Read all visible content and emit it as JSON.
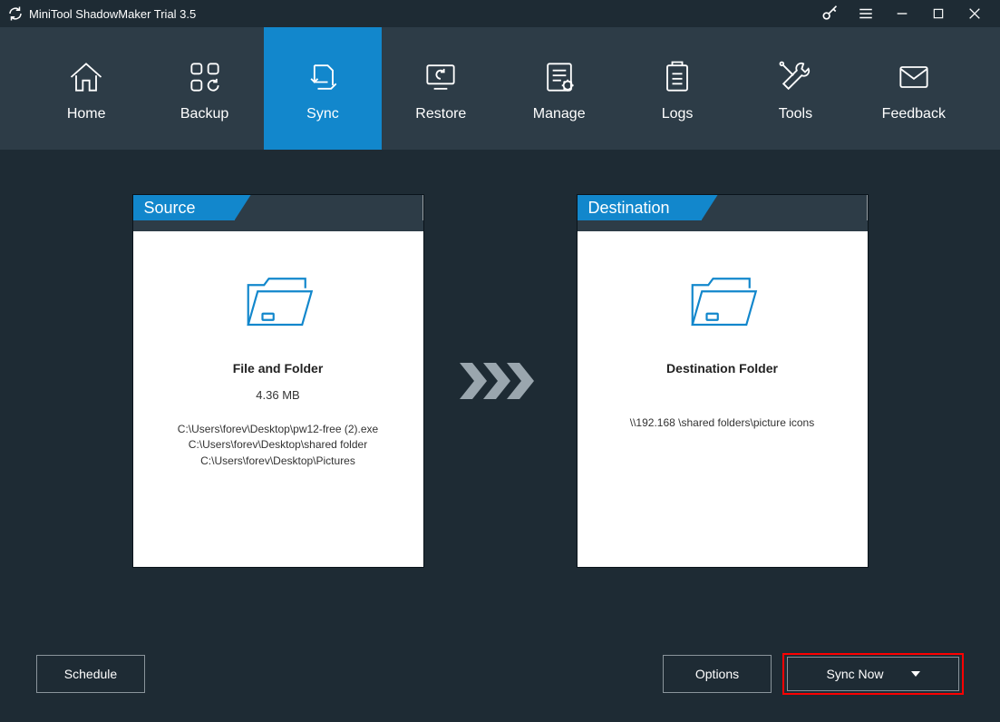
{
  "app": {
    "title": "MiniTool ShadowMaker Trial 3.5"
  },
  "nav": {
    "items": [
      {
        "label": "Home"
      },
      {
        "label": "Backup"
      },
      {
        "label": "Sync"
      },
      {
        "label": "Restore"
      },
      {
        "label": "Manage"
      },
      {
        "label": "Logs"
      },
      {
        "label": "Tools"
      },
      {
        "label": "Feedback"
      }
    ],
    "active": "Sync"
  },
  "source": {
    "title": "Source",
    "heading": "File and Folder",
    "size": "4.36 MB",
    "paths": [
      "C:\\Users\\forev\\Desktop\\pw12-free (2).exe",
      "C:\\Users\\forev\\Desktop\\shared folder",
      "C:\\Users\\forev\\Desktop\\Pictures"
    ]
  },
  "destination": {
    "title": "Destination",
    "heading": "Destination Folder",
    "path": "\\\\192.168        \\shared folders\\picture icons"
  },
  "buttons": {
    "schedule": "Schedule",
    "options": "Options",
    "sync_now": "Sync Now"
  }
}
